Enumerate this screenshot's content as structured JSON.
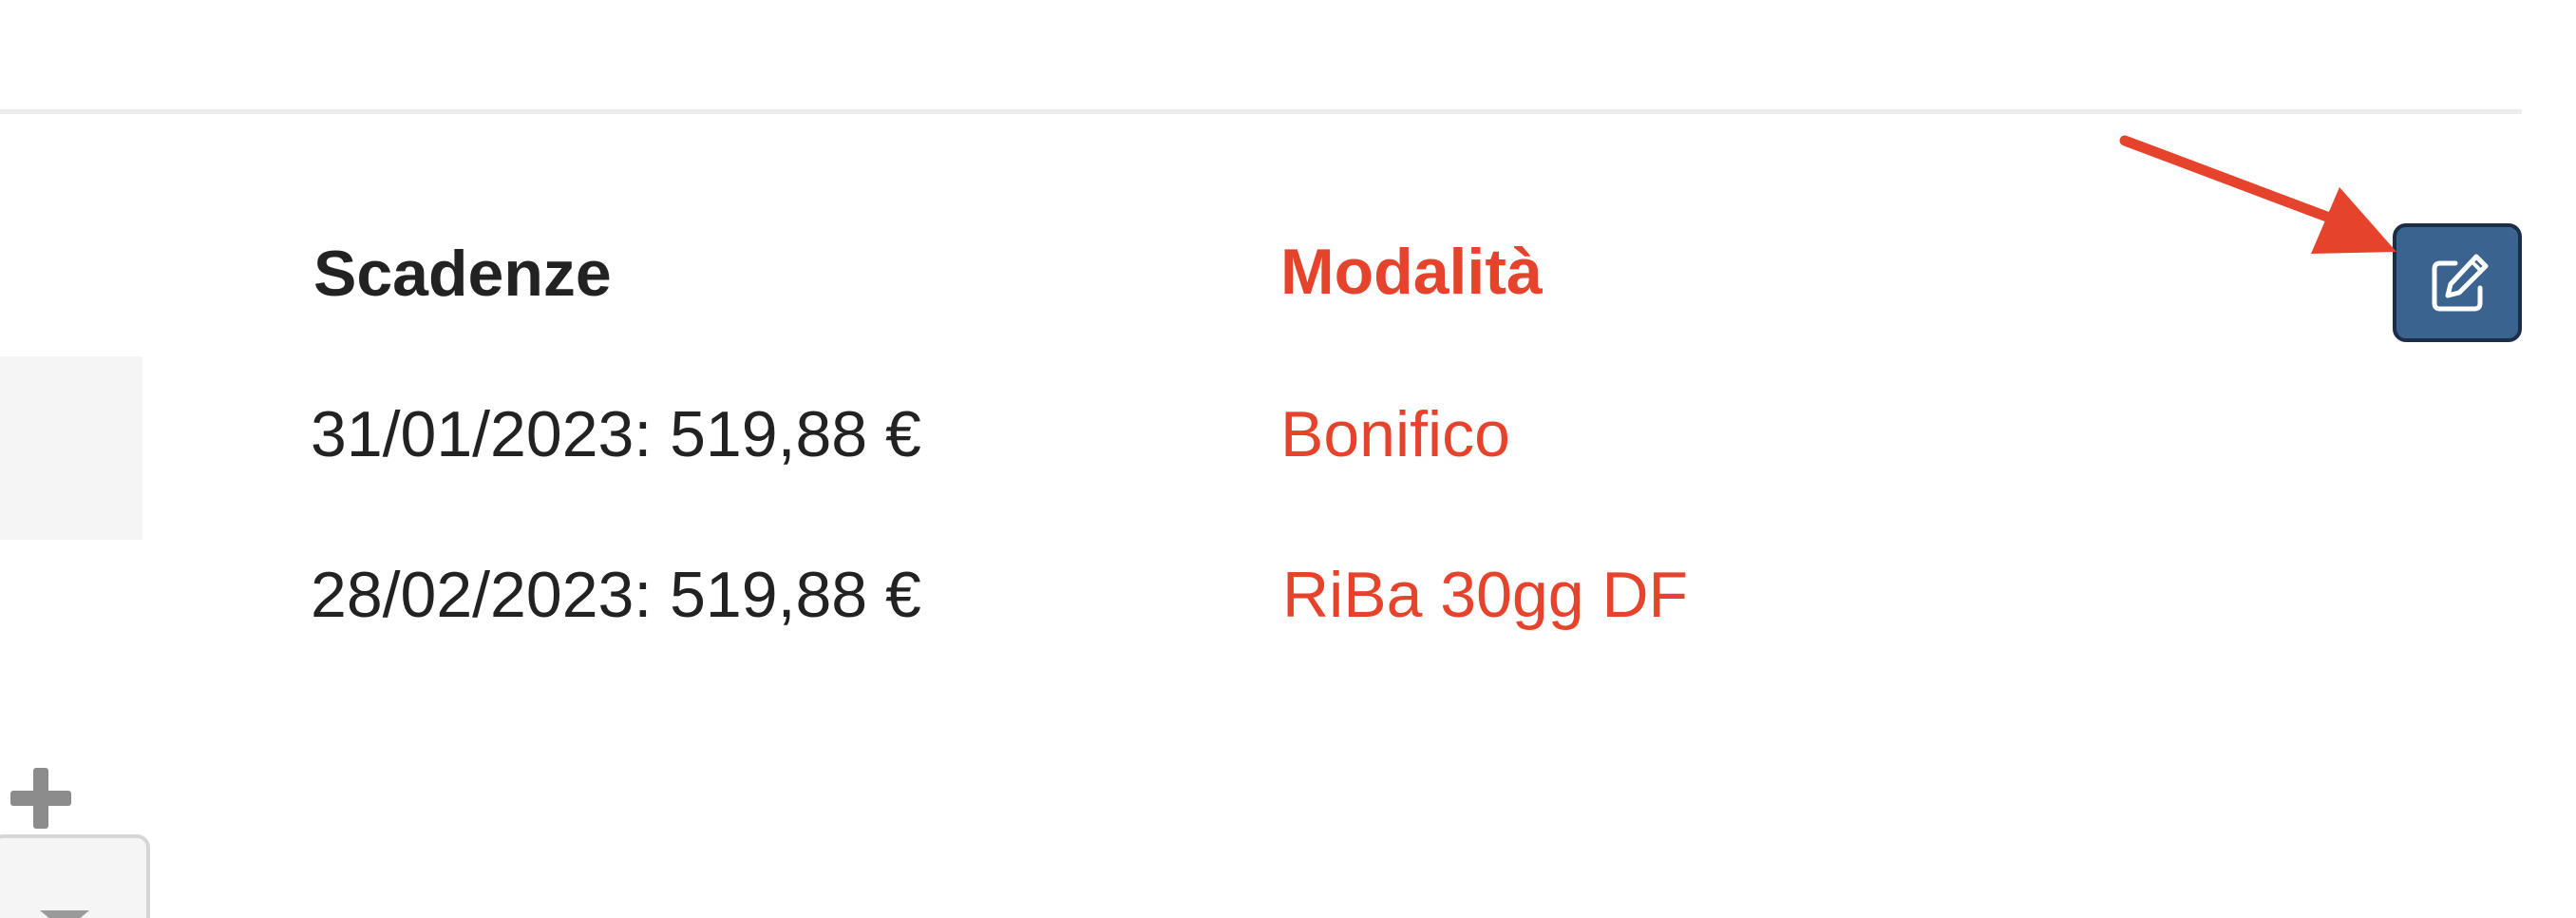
{
  "colors": {
    "accent": "#e5432b",
    "text": "#222222",
    "button": "#3a6390",
    "button_border": "#1c2e47",
    "muted": "#8c8c8c",
    "divider": "#ececec"
  },
  "headers": {
    "due": "Scadenze",
    "mode": "Modalità"
  },
  "rows": [
    {
      "due": "31/01/2023: 519,88 €",
      "mode": "Bonifico"
    },
    {
      "due": "28/02/2023: 519,88 €",
      "mode": "RiBa 30gg DF"
    }
  ],
  "icons": {
    "expand": "plus-icon",
    "edit": "pencil-square-icon",
    "dropdown": "chevron-down-icon",
    "annotation": "red-arrow-icon"
  }
}
